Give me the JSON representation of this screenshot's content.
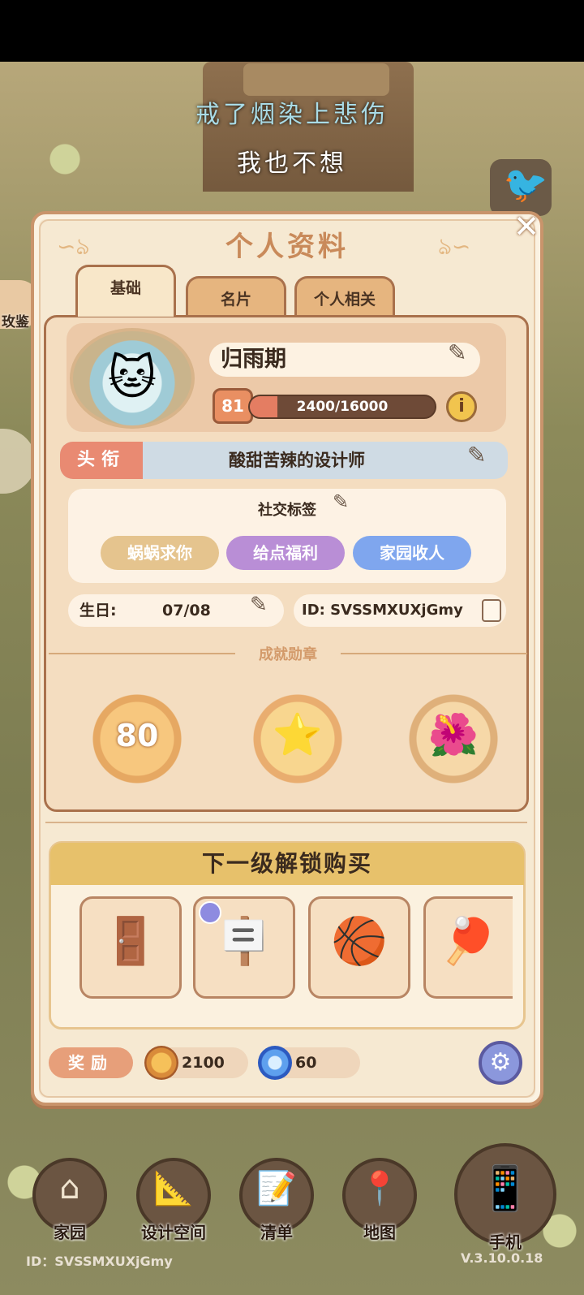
{
  "caption": {
    "line1": "戒了烟染上悲伤",
    "line2": "我也不想"
  },
  "side": {
    "left_label": "玫鉴"
  },
  "panel": {
    "title": "个人资料",
    "close_icon": "✕",
    "tabs": [
      {
        "label": "基础",
        "active": true
      },
      {
        "label": "名片",
        "active": false
      },
      {
        "label": "个人相关",
        "active": false
      }
    ]
  },
  "profile": {
    "name": "归雨期",
    "level": "81",
    "xp_text": "2400/16000",
    "xp_fraction": 0.15,
    "info_icon": "i"
  },
  "title_row": {
    "label": "头衔",
    "value": "酸甜苦辣的设计师"
  },
  "social": {
    "title": "社交标签",
    "tags": [
      "蜗蜗求你",
      "给点福利",
      "家园收人"
    ]
  },
  "birthday": {
    "label": "生日:",
    "value": "07/08"
  },
  "user_id": {
    "text": "ID: SVSSMXUXjGmy"
  },
  "achievements": {
    "title": "成就勋章",
    "badges": [
      {
        "text": "80",
        "icon": "level-80-badge"
      },
      {
        "icon": "constellation-star-badge"
      },
      {
        "icon": "flower-pot-badge"
      }
    ]
  },
  "unlock": {
    "title": "下一级解锁购买",
    "items": [
      {
        "icon": "wardrobe-icon"
      },
      {
        "icon": "easel-board-icon"
      },
      {
        "icon": "basketball-icon"
      },
      {
        "icon": "ping-pong-icon"
      }
    ]
  },
  "reward": {
    "label": "奖励",
    "coins": "2100",
    "gems": "60"
  },
  "nav": {
    "items": [
      {
        "label": "家园",
        "icon": "home-icon"
      },
      {
        "label": "设计空间",
        "icon": "design-ruler-icon"
      },
      {
        "label": "清单",
        "icon": "list-icon"
      },
      {
        "label": "地图",
        "icon": "map-pin-icon"
      },
      {
        "label": "手机",
        "icon": "phone-icon"
      }
    ]
  },
  "footer": {
    "id": "ID：SVSSMXUXjGmy",
    "version": "V.3.10.0.18"
  }
}
